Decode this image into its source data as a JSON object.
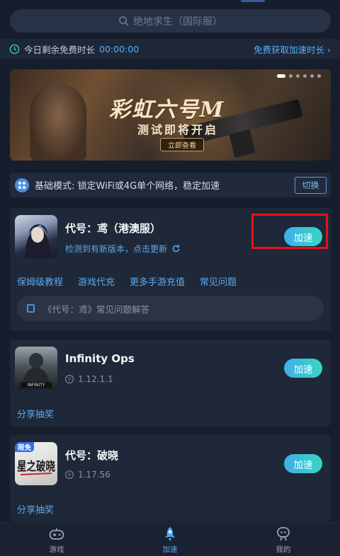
{
  "search": {
    "placeholder": "绝地求生（国际服）"
  },
  "free_bar": {
    "label": "今日剩余免费时长",
    "time": "00:00:00",
    "get_more": "免费获取加速时长 ›"
  },
  "banner": {
    "title": "彩虹六号M",
    "subtitle": "测试即将开启",
    "button": "立即查看",
    "dot_count": 6,
    "active_dot": 0
  },
  "mode": {
    "text": "基础模式: 锁定WiFi或4G单个网络，稳定加速",
    "switch_label": "切换"
  },
  "games": [
    {
      "name": "代号：鸢（港澳服）",
      "sub": "检测到有新版本，点击更新",
      "accel_label": "加速",
      "links": [
        "保姆级教程",
        "游戏代充",
        "更多手游充值",
        "常见问题"
      ],
      "faq": "《代号：鸢》常见问题解答"
    },
    {
      "name": "Infinity Ops",
      "version": "1.12.1.1",
      "accel_label": "加速",
      "share": "分享抽奖",
      "icon_text": "INFINITY"
    },
    {
      "name": "代号：破晓",
      "version": "1.17.56",
      "accel_label": "加速",
      "share": "分享抽奖",
      "badge": "限免",
      "icon_text": "星之破晓"
    }
  ],
  "nav": [
    {
      "label": "游戏",
      "icon": "gamepad-icon",
      "active": false
    },
    {
      "label": "加速",
      "icon": "rocket-icon",
      "active": true
    },
    {
      "label": "我的",
      "icon": "profile-icon",
      "active": false
    }
  ],
  "colors": {
    "accent": "#5ba9ef",
    "highlight_box": "#e8101a",
    "background": "#161d2c"
  }
}
